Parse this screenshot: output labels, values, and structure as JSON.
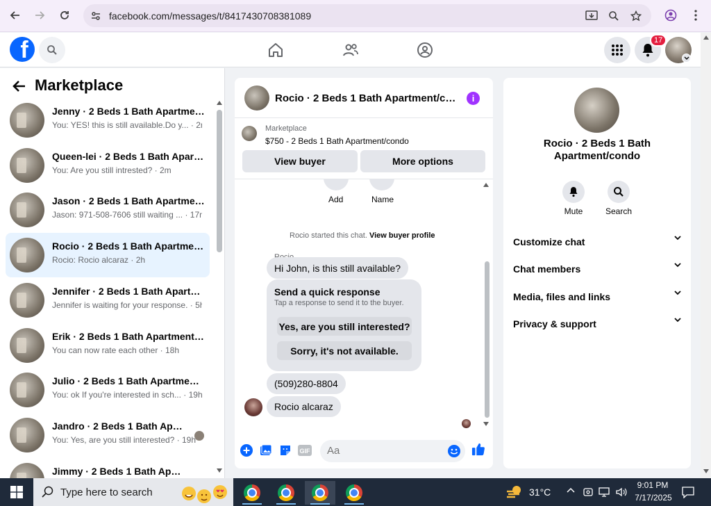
{
  "browser": {
    "url": "facebook.com/messages/t/8417430708381089"
  },
  "header": {
    "notification_count": "17"
  },
  "marketplace": {
    "title": "Marketplace",
    "conversations": [
      {
        "name": "Jenny · 2 Beds 1 Bath Apartment...",
        "preview": "You: YES! this is still available.Do y... · 2m"
      },
      {
        "name": "Queen-lei · 2 Beds 1 Bath Apart...",
        "preview": "You: Are you still intrested? · 2m"
      },
      {
        "name": "Jason · 2 Beds 1 Bath Apartment...",
        "preview": "Jason: 971-508-7606 still waiting ... · 17m"
      },
      {
        "name": "Rocio · 2 Beds 1 Bath Apartment...",
        "preview": "Rocio: Rocio alcaraz · 2h"
      },
      {
        "name": "Jennifer · 2 Beds 1 Bath Apartm...",
        "preview": "Jennifer is waiting for your response. · 5h"
      },
      {
        "name": "Erik · 2 Beds 1 Bath Apartment/c...",
        "preview": "You can now rate each other · 18h"
      },
      {
        "name": "Julio · 2 Beds 1 Bath Apartment/...",
        "preview": "You: ok If you're interested in sch... · 19h"
      },
      {
        "name": "Jandro · 2 Beds 1 Bath Apart...",
        "preview": "You: Yes, are you still interested? · 19h"
      },
      {
        "name": "Jimmy · 2 Beds 1 Bath Apartm...",
        "preview": ""
      }
    ]
  },
  "chat": {
    "title": "Rocio · 2 Beds 1 Bath Apartment/condo",
    "listing_label": "Marketplace",
    "listing_price": "$750 - 2 Beds 1 Bath Apartment/condo",
    "view_buyer": "View buyer",
    "more_options": "More options",
    "add_label": "Add",
    "name_label": "Name",
    "system_text": "Rocio started this chat.",
    "system_link": "View buyer profile",
    "sender": "Rocio",
    "msg1": "Hi John, is this still available?",
    "quick_title": "Send a quick response",
    "quick_sub": "Tap a response to send it to the buyer.",
    "quick_opt1": "Yes, are you still interested?",
    "quick_opt2": "Sorry, it's not available.",
    "msg2": "(509)280-8804",
    "msg3": "Rocio alcaraz",
    "input_placeholder": "Aa"
  },
  "details": {
    "name": "Rocio · 2 Beds 1 Bath Apartment/condo",
    "mute": "Mute",
    "search": "Search",
    "sections": [
      "Customize chat",
      "Chat members",
      "Media, files and links",
      "Privacy & support"
    ]
  },
  "taskbar": {
    "search_placeholder": "Type here to search",
    "weather": "31°C",
    "time": "9:01 PM",
    "date": "7/17/2025"
  },
  "colors": {
    "fb_blue": "#0866ff",
    "messenger_purple": "#a033ff",
    "active_row": "#e7f3ff"
  }
}
